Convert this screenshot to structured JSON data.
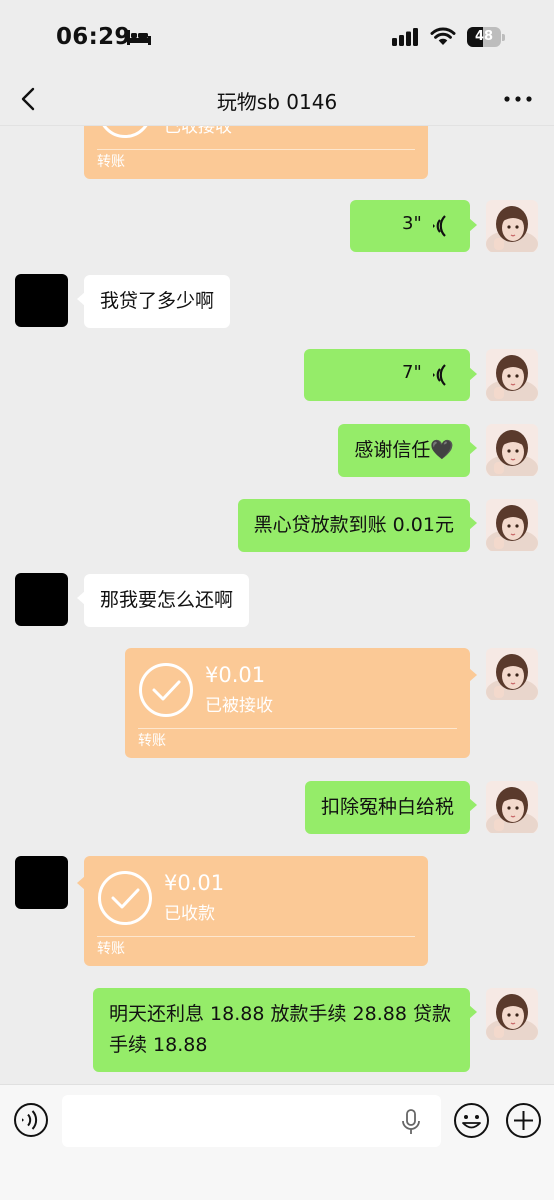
{
  "status_bar": {
    "time": "06:29",
    "battery_level": "48"
  },
  "header": {
    "title": "玩物sb 0146"
  },
  "messages": [
    {
      "id": "m0",
      "from": "other",
      "type": "transfer",
      "status": "已收接收",
      "label": "转账"
    },
    {
      "id": "m1",
      "from": "self",
      "type": "voice",
      "duration": "3\""
    },
    {
      "id": "m2",
      "from": "other",
      "type": "text",
      "text": "我贷了多少啊"
    },
    {
      "id": "m3",
      "from": "self",
      "type": "voice",
      "duration": "7\""
    },
    {
      "id": "m4",
      "from": "self",
      "type": "text",
      "text": "感谢信任🖤"
    },
    {
      "id": "m5",
      "from": "self",
      "type": "text",
      "text": "黑心贷放款到账 0.01元"
    },
    {
      "id": "m6",
      "from": "other",
      "type": "text",
      "text": "那我要怎么还啊"
    },
    {
      "id": "m7",
      "from": "self",
      "type": "transfer",
      "amount": "¥0.01",
      "status": "已被接收",
      "label": "转账"
    },
    {
      "id": "m8",
      "from": "self",
      "type": "text",
      "text": "扣除冤种白给税"
    },
    {
      "id": "m9",
      "from": "other",
      "type": "transfer",
      "amount": "¥0.01",
      "status": "已收款",
      "label": "转账"
    },
    {
      "id": "m10",
      "from": "self",
      "type": "text",
      "text": "明天还利息 18.88 放款手续 28.88 贷款手续 18.88"
    }
  ],
  "input": {
    "placeholder": ""
  },
  "colors": {
    "self_bubble": "#95ec69",
    "transfer": "#fbc996",
    "background": "#ededed"
  },
  "icons": [
    "bed-icon",
    "cellular-signal-icon",
    "wifi-icon",
    "back-chevron-icon",
    "more-dots-icon",
    "voice-wave-icon",
    "check-circle-icon",
    "microphone-icon",
    "emoji-icon",
    "plus-icon"
  ]
}
